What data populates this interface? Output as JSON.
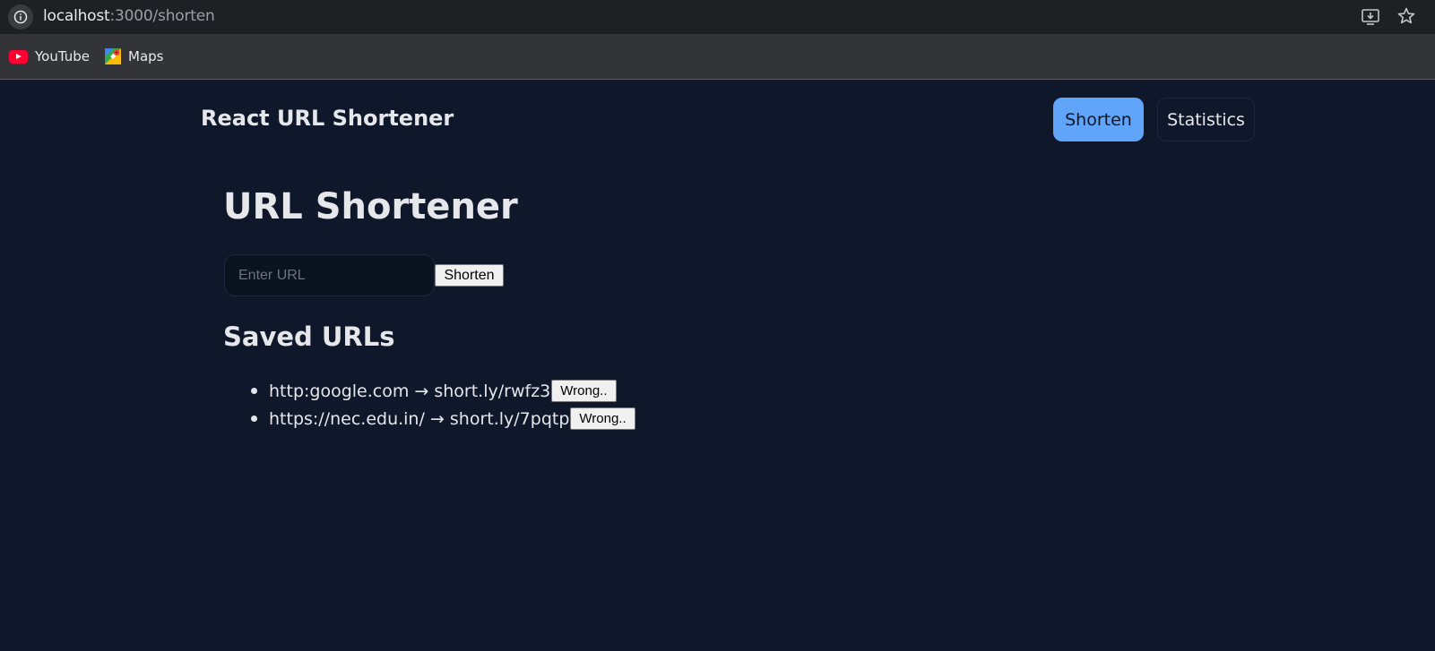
{
  "browser": {
    "url_host": "localhost",
    "url_rest": ":3000/shorten",
    "bookmarks": [
      {
        "label": "YouTube",
        "icon": "youtube-icon"
      },
      {
        "label": "Maps",
        "icon": "maps-icon"
      }
    ]
  },
  "header": {
    "title": "React URL Shortener",
    "nav": [
      {
        "label": "Shorten",
        "active": true
      },
      {
        "label": "Statistics",
        "active": false
      }
    ]
  },
  "main": {
    "title": "URL Shortener",
    "input_placeholder": "Enter URL",
    "input_value": "",
    "submit_label": "Shorten",
    "saved_title": "Saved URLs",
    "saved": [
      {
        "text": "http:google.com → short.ly/rwfz3",
        "button": "Wrong.."
      },
      {
        "text": "https://nec.edu.in/ → short.ly/7pqtp",
        "button": "Wrong.."
      }
    ]
  },
  "colors": {
    "page_bg": "#0f172a",
    "accent": "#60a5fa",
    "text": "#e5e7eb"
  }
}
